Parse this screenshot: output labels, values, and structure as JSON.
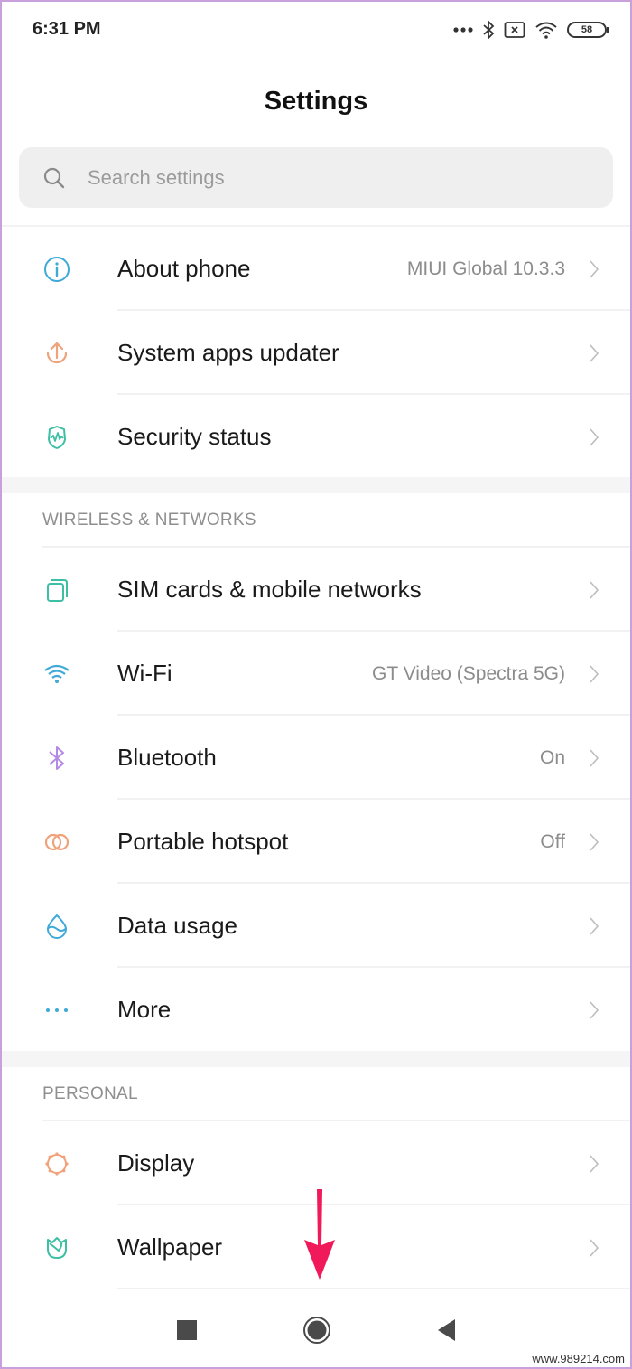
{
  "status_bar": {
    "time": "6:31 PM",
    "battery": "58",
    "icons": [
      "more-dots-icon",
      "bluetooth-icon",
      "no-sim-icon",
      "wifi-icon",
      "battery-icon"
    ]
  },
  "header": {
    "title": "Settings"
  },
  "search": {
    "placeholder": "Search settings",
    "value": "",
    "icon": "search-icon"
  },
  "groups": [
    {
      "header": null,
      "items": [
        {
          "label": "About phone",
          "value": "MIUI Global 10.3.3",
          "icon": "info-icon",
          "color": "#3fa9d8"
        },
        {
          "label": "System apps updater",
          "value": "",
          "icon": "update-arrow-icon",
          "color": "#f0a27a"
        },
        {
          "label": "Security status",
          "value": "",
          "icon": "shield-pulse-icon",
          "color": "#3dbfa3"
        }
      ]
    },
    {
      "header": "WIRELESS & NETWORKS",
      "items": [
        {
          "label": "SIM cards & mobile networks",
          "value": "",
          "icon": "sim-cards-icon",
          "color": "#3dbfa3"
        },
        {
          "label": "Wi-Fi",
          "value": "GT Video (Spectra 5G)",
          "icon": "wifi-icon",
          "color": "#3fa9d8"
        },
        {
          "label": "Bluetooth",
          "value": "On",
          "icon": "bluetooth-icon",
          "color": "#b58ae6"
        },
        {
          "label": "Portable hotspot",
          "value": "Off",
          "icon": "hotspot-rings-icon",
          "color": "#f0a27a"
        },
        {
          "label": "Data usage",
          "value": "",
          "icon": "water-drop-icon",
          "color": "#3fa9d8"
        },
        {
          "label": "More",
          "value": "",
          "icon": "more-dots-icon",
          "color": "#3fa9d8"
        }
      ]
    },
    {
      "header": "PERSONAL",
      "items": [
        {
          "label": "Display",
          "value": "",
          "icon": "sun-icon",
          "color": "#f0a27a"
        },
        {
          "label": "Wallpaper",
          "value": "",
          "icon": "tulip-icon",
          "color": "#3dbfa3"
        }
      ]
    }
  ],
  "nav_bar": {
    "buttons": [
      {
        "name": "recents",
        "icon": "square-icon"
      },
      {
        "name": "home",
        "icon": "circle-home-icon"
      },
      {
        "name": "back",
        "icon": "triangle-back-icon"
      }
    ]
  },
  "annotation": {
    "type": "arrow-down",
    "color": "#f0195a",
    "points_to": "home"
  },
  "watermark": "www.989214.com"
}
